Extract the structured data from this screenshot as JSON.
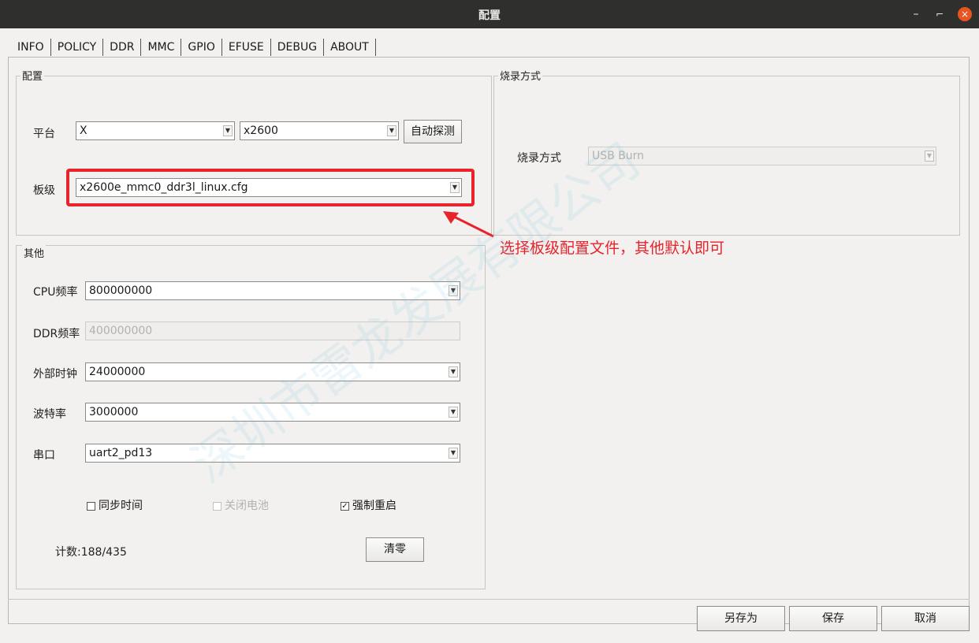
{
  "window": {
    "title": "配置",
    "minimize": "–",
    "maximize": "⌐",
    "close": "×"
  },
  "tabs": [
    "INFO",
    "POLICY",
    "DDR",
    "MMC",
    "GPIO",
    "EFUSE",
    "DEBUG",
    "ABOUT"
  ],
  "config_group": {
    "title": "配置",
    "platform_label": "平台",
    "platform_value": "X",
    "chip_value": "x2600",
    "auto_detect_button": "自动探测",
    "board_label": "板级",
    "board_value": "x2600e_mmc0_ddr3l_linux.cfg"
  },
  "burn_group": {
    "title": "烧录方式",
    "mode_label": "烧录方式",
    "mode_value": "USB Burn"
  },
  "other_group": {
    "title": "其他",
    "cpu_freq_label": "CPU频率",
    "cpu_freq_value": "800000000",
    "ddr_freq_label": "DDR频率",
    "ddr_freq_value": "400000000",
    "ext_clock_label": "外部时钟",
    "ext_clock_value": "24000000",
    "baud_label": "波特率",
    "baud_value": "3000000",
    "serial_label": "串口",
    "serial_value": "uart2_pd13",
    "sync_time_label": "同步时间",
    "power_off_label": "关闭电池",
    "force_erase_label": "强制重启",
    "count_text": "计数:188/435",
    "clear_button": "清零"
  },
  "annotation": {
    "text": "选择板级配置文件，其他默认即可",
    "color": "#e8232b"
  },
  "watermark": "深圳市雷龙发展有限公司",
  "footer": {
    "save_as_button": "另存为",
    "save_button": "保存",
    "cancel_button": "取消"
  }
}
